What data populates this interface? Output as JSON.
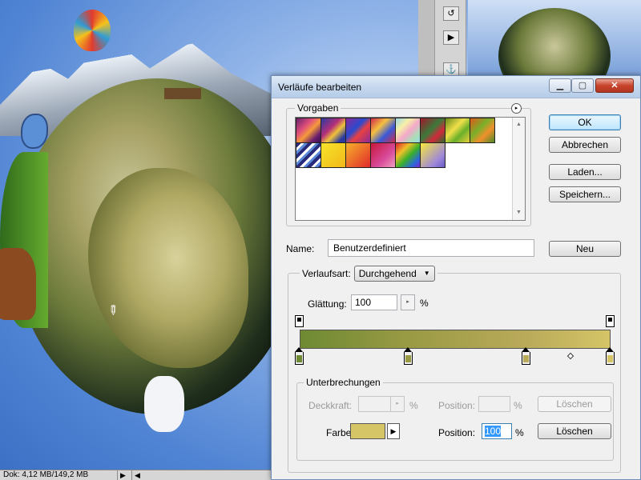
{
  "background_doc": {
    "status_text": "Dok: 4,12 MB/149,2 MB",
    "status_arrow": "▶",
    "status_left_arrow": "◀"
  },
  "dialog": {
    "title": "Verläufe bearbeiten",
    "window_buttons": {
      "minimize": "▁",
      "maximize": "▢",
      "close": "✕"
    },
    "vorgaben": {
      "legend": "Vorgaben",
      "menu_icon": "▸",
      "swatches": [
        {
          "name": "violet-orange",
          "css": "linear-gradient(135deg,#6a1f6e,#e0507a 35%,#f59a3a 55%,#6a1f6e 80%,#3a0c4c)"
        },
        {
          "name": "blue-red-yellow",
          "css": "linear-gradient(135deg,#2a3aa0,#b4307a 40%,#f0c23a 60%,#2a3aa0 85%)"
        },
        {
          "name": "blue-red-diag",
          "css": "linear-gradient(135deg,#8a2a9a,#2a4ad0 40%,#e84040 60%,#8a2a9a)"
        },
        {
          "name": "red-violet",
          "css": "linear-gradient(135deg,#d02a4a,#f5c040 35%,#3a5ad8 65%,#d02a4a)"
        },
        {
          "name": "pastel-rainbow",
          "css": "linear-gradient(135deg,#9ad7e8,#f7f0a8 30%,#f3a8c8 55%,#a8e0b8 80%,#9ad7e8)"
        },
        {
          "name": "red-green",
          "css": "linear-gradient(135deg,#a0182a,#3a7a3a 45%,#d02a3a 70%,#2a6a2a)"
        },
        {
          "name": "yellow-green",
          "css": "linear-gradient(135deg,#6a8a1a,#f0e04a 40%,#6ab02a 65%,#e8d03a)"
        },
        {
          "name": "orange-green",
          "css": "linear-gradient(135deg,#e05a1a,#7ab02a 40%,#f0902a 65%,#4a8a2a)"
        },
        {
          "name": "blue-white-stripes",
          "css": "repeating-linear-gradient(135deg,#2a2a7a 0 4px,#ffffff 4px 7px,#5a8ad8 7px 10px)"
        },
        {
          "name": "yellow-solid",
          "css": "linear-gradient(135deg,#f8e42a,#f0b81a)"
        },
        {
          "name": "orange-red",
          "css": "linear-gradient(135deg,#f8b02a,#e02a2a)"
        },
        {
          "name": "red-violet-pink",
          "css": "linear-gradient(135deg,#c8183a,#d84a9a 60%,#f0a0c0)"
        },
        {
          "name": "spectrum",
          "css": "linear-gradient(135deg,#e0202a,#f0c02a 30%,#3ab02a 55%,#2a6ad8 80%,#7a2ad0)"
        },
        {
          "name": "yellow-violet",
          "css": "linear-gradient(135deg,#f8e83a,#a08ad8 70%,#6a5ac8)"
        }
      ],
      "scroll_up": "▲",
      "scroll_down": "▼"
    },
    "buttons": {
      "ok": "OK",
      "cancel": "Abbrechen",
      "load": "Laden...",
      "save": "Speichern...",
      "new": "Neu"
    },
    "name_label": "Name:",
    "name_value": "Benutzerdefiniert",
    "gradient_type_label": "Verlaufsart:",
    "gradient_type_value": "Durchgehend",
    "gradient_type_arrow": "▼",
    "smoothness_label": "Glättung:",
    "smoothness_value": "100",
    "smoothness_stepper": "▸",
    "percent": "%",
    "gradient": {
      "colors": [
        "#6e8a33",
        "#9a9a44",
        "#b9aa5a",
        "#dbc970"
      ],
      "opacity_stops": [
        0,
        100
      ],
      "color_stops": [
        {
          "location": 0,
          "color": "#6e8a33"
        },
        {
          "location": 35,
          "color": "#9a9a44"
        },
        {
          "location": 73,
          "color": "#b9aa5a"
        },
        {
          "location": 100,
          "color": "#d5c567"
        }
      ],
      "midpoints": [
        87
      ]
    },
    "stops_section": {
      "legend": "Unterbrechungen",
      "opacity_label": "Deckkraft:",
      "opacity_unit": "%",
      "opacity_position_label": "Position:",
      "opacity_position_unit": "%",
      "opacity_delete": "Löschen",
      "color_label": "Farbe:",
      "color_value": "#d5c567",
      "color_menu_icon": "▶",
      "color_position_label": "Position:",
      "color_position_value": "100",
      "color_position_unit": "%",
      "color_delete": "Löschen",
      "stepper_icon": "▸"
    }
  }
}
